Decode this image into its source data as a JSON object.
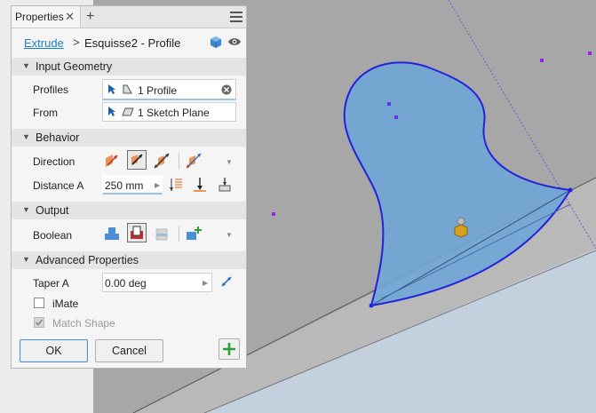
{
  "panel": {
    "tab_label": "Properties",
    "close_glyph": "✕",
    "add_glyph": "+",
    "menu_icon": "hamburger-menu-icon"
  },
  "breadcrumb": {
    "command": "Extrude",
    "separator": ">",
    "title": "Esquisse2 - Profile"
  },
  "sections": {
    "input_geometry": "Input Geometry",
    "behavior": "Behavior",
    "output": "Output",
    "advanced": "Advanced Properties"
  },
  "input_geometry": {
    "profiles_label": "Profiles",
    "profiles_value": "1 Profile",
    "from_label": "From",
    "from_value": "1 Sketch Plane"
  },
  "behavior": {
    "direction_label": "Direction",
    "distance_label": "Distance A",
    "distance_value": "250 mm"
  },
  "output": {
    "boolean_label": "Boolean"
  },
  "advanced": {
    "taper_label": "Taper A",
    "taper_value": "0.00 deg",
    "imate_label": "iMate",
    "match_shape_label": "Match Shape",
    "imate_checked": false,
    "match_shape_checked": true
  },
  "footer": {
    "ok_label": "OK",
    "cancel_label": "Cancel"
  },
  "colors": {
    "accent": "#1b7fc9",
    "profile_fill": "#6fa6d6",
    "profile_edge": "#2222dd",
    "sketch_point": "#8a2be2",
    "add_green": "#2e9e3a"
  }
}
